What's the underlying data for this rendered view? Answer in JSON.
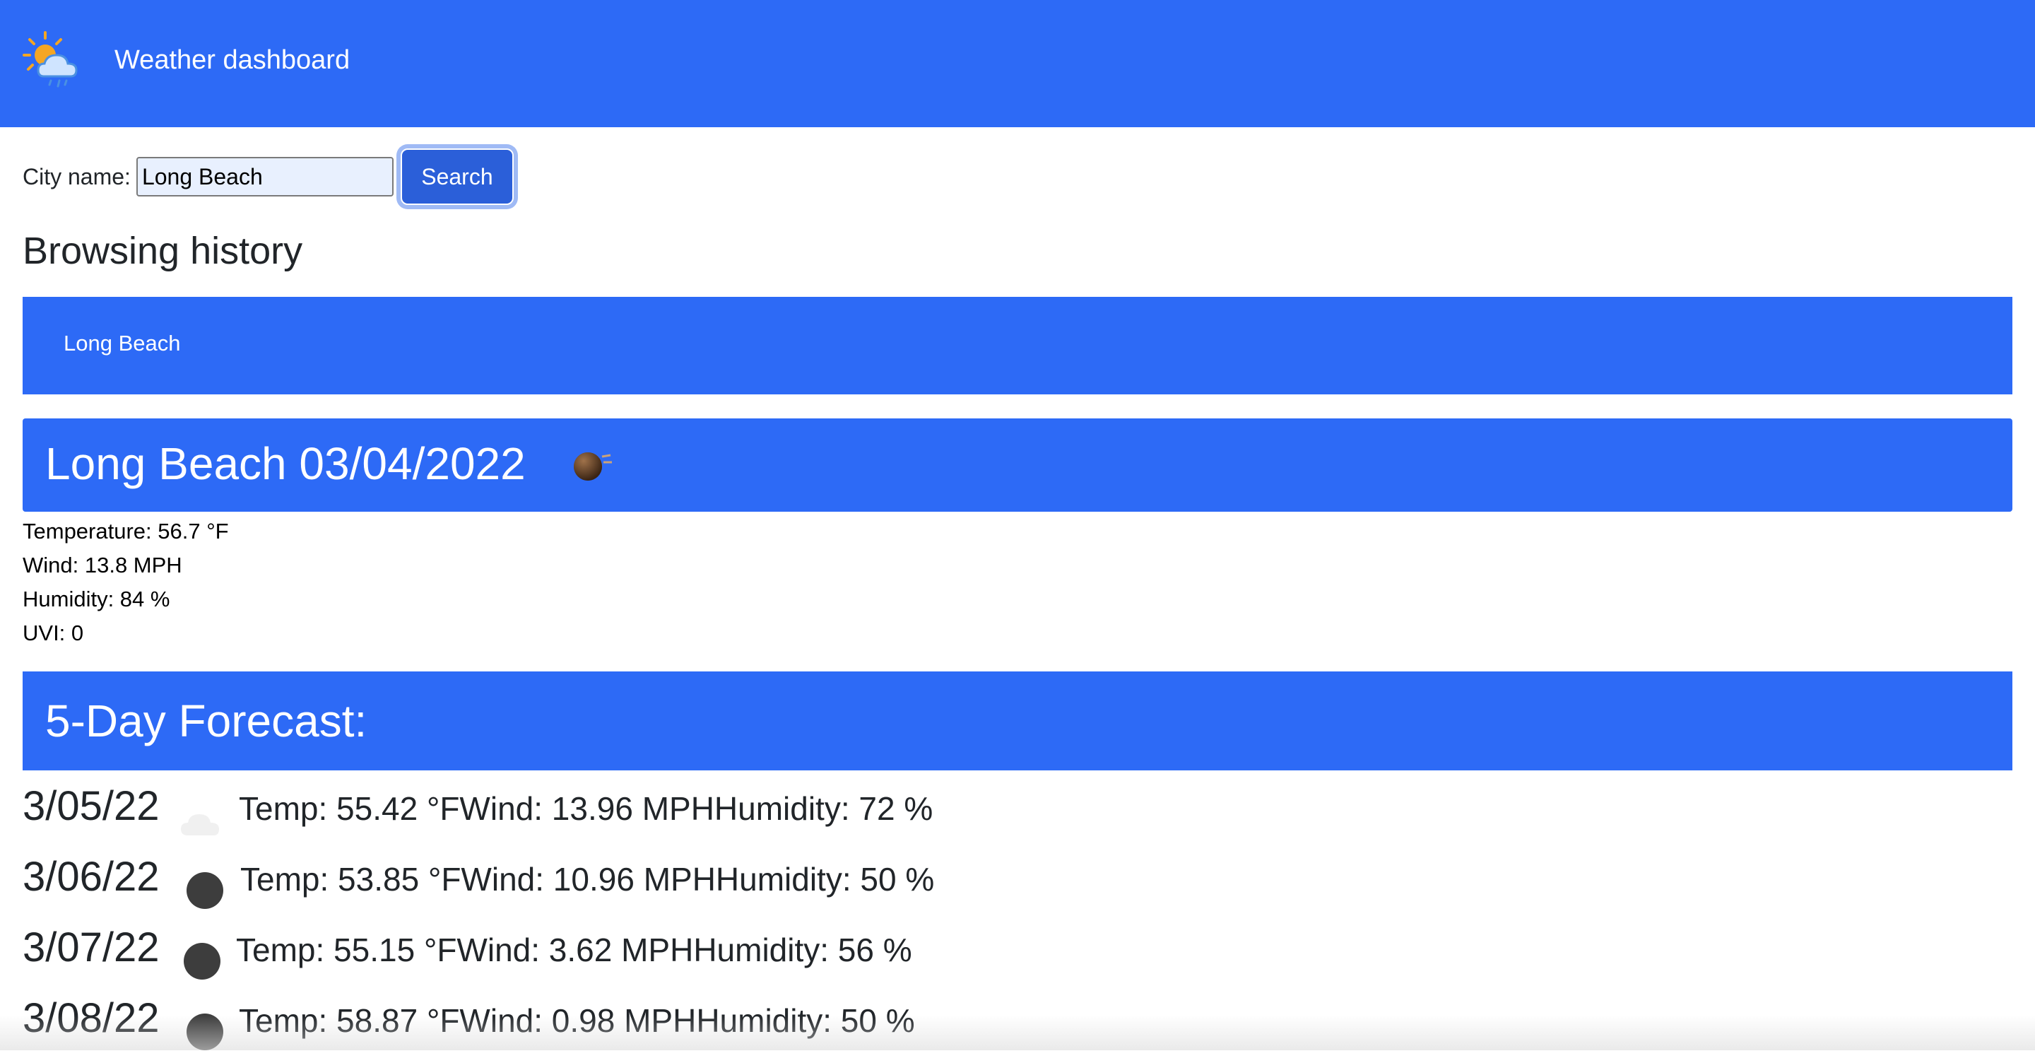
{
  "header": {
    "logo_icon": "sun-cloud-rain-icon",
    "brand": "Weather dashboard",
    "color": "#2d6af6"
  },
  "search": {
    "label": "City name:",
    "value": "Long Beach",
    "button_label": "Search"
  },
  "history": {
    "heading": "Browsing history",
    "items": [
      "Long Beach"
    ]
  },
  "current": {
    "title": "Long Beach 03/04/2022",
    "icon": "night-clear-icon",
    "stats": {
      "temperature": "Temperature: 56.7 °F",
      "wind": "Wind: 13.8 MPH",
      "humidity": "Humidity: 84 %",
      "uvi": "UVI: 0"
    }
  },
  "forecast": {
    "heading": "5-Day Forecast:",
    "days": [
      {
        "date": "3/05/22",
        "icon": "cloud-icon",
        "summary": "Temp: 55.42 °FWind: 13.96 MPHHumidity: 72 %"
      },
      {
        "date": "3/06/22",
        "icon": "dark-circle-icon",
        "summary": "Temp: 53.85 °FWind: 10.96 MPHHumidity: 50 %"
      },
      {
        "date": "3/07/22",
        "icon": "dark-circle-icon",
        "summary": "Temp: 55.15 °FWind: 3.62 MPHHumidity: 56 %"
      },
      {
        "date": "3/08/22",
        "icon": "dark-circle-icon",
        "summary": "Temp: 58.87 °FWind: 0.98 MPHHumidity: 50 %"
      }
    ]
  }
}
